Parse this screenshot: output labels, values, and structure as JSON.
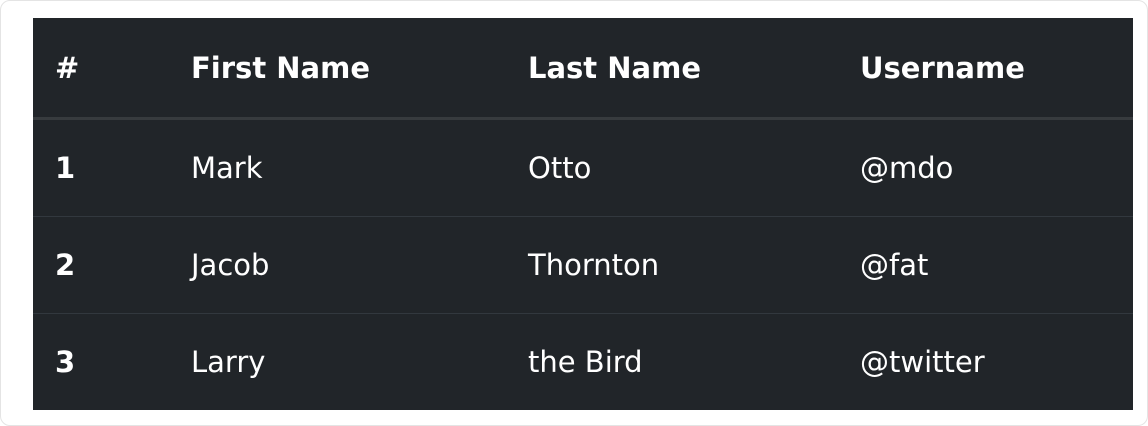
{
  "table": {
    "headers": [
      "#",
      "First Name",
      "Last Name",
      "Username"
    ],
    "rows": [
      {
        "num": "1",
        "first": "Mark",
        "last": "Otto",
        "username": "@mdo"
      },
      {
        "num": "2",
        "first": "Jacob",
        "last": "Thornton",
        "username": "@fat"
      },
      {
        "num": "3",
        "first": "Larry",
        "last": "the Bird",
        "username": "@twitter"
      }
    ]
  },
  "colors": {
    "table_background": "#212529",
    "text": "#ffffff",
    "header_divider": "#373b3e",
    "row_divider": "#32383e"
  }
}
